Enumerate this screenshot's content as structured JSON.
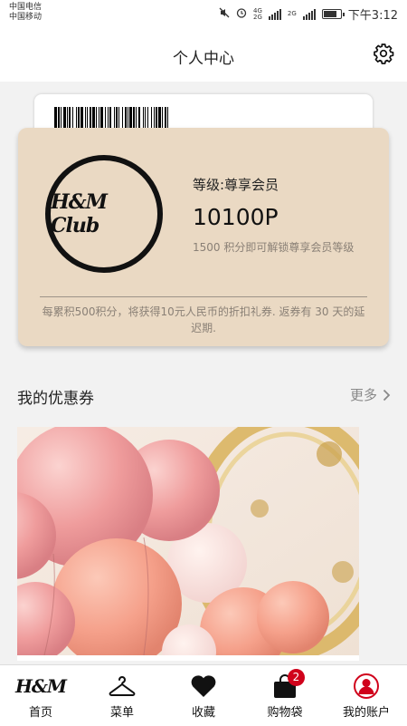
{
  "status_bar": {
    "carriers": [
      "中国电信",
      "中国移动"
    ],
    "network": {
      "top": "4G",
      "bottom": "2G",
      "second": "2G"
    },
    "time": "下午3:12"
  },
  "header": {
    "title": "个人中心",
    "settings_icon": "gear-icon"
  },
  "club_card": {
    "logo_text": "H&M Club",
    "level": "等级:尊享会员",
    "points": "10100P",
    "unlock_hint": "1500 积分即可解锁尊享会员等级",
    "rule": "每累积500积分，将获得10元人民币的折扣礼券. 返券有 30 天的延迟期."
  },
  "coupons": {
    "title": "我的优惠券",
    "more_label": "更多"
  },
  "tabbar": {
    "items": [
      {
        "label": "首页",
        "icon": "hm-logo-icon"
      },
      {
        "label": "菜单",
        "icon": "hanger-icon"
      },
      {
        "label": "收藏",
        "icon": "heart-icon"
      },
      {
        "label": "购物袋",
        "icon": "bag-icon",
        "badge": "2"
      },
      {
        "label": "我的账户",
        "icon": "account-icon"
      }
    ]
  },
  "colors": {
    "card_bg": "#ead9c3",
    "badge": "#d0021b",
    "account_red": "#d0021b"
  }
}
